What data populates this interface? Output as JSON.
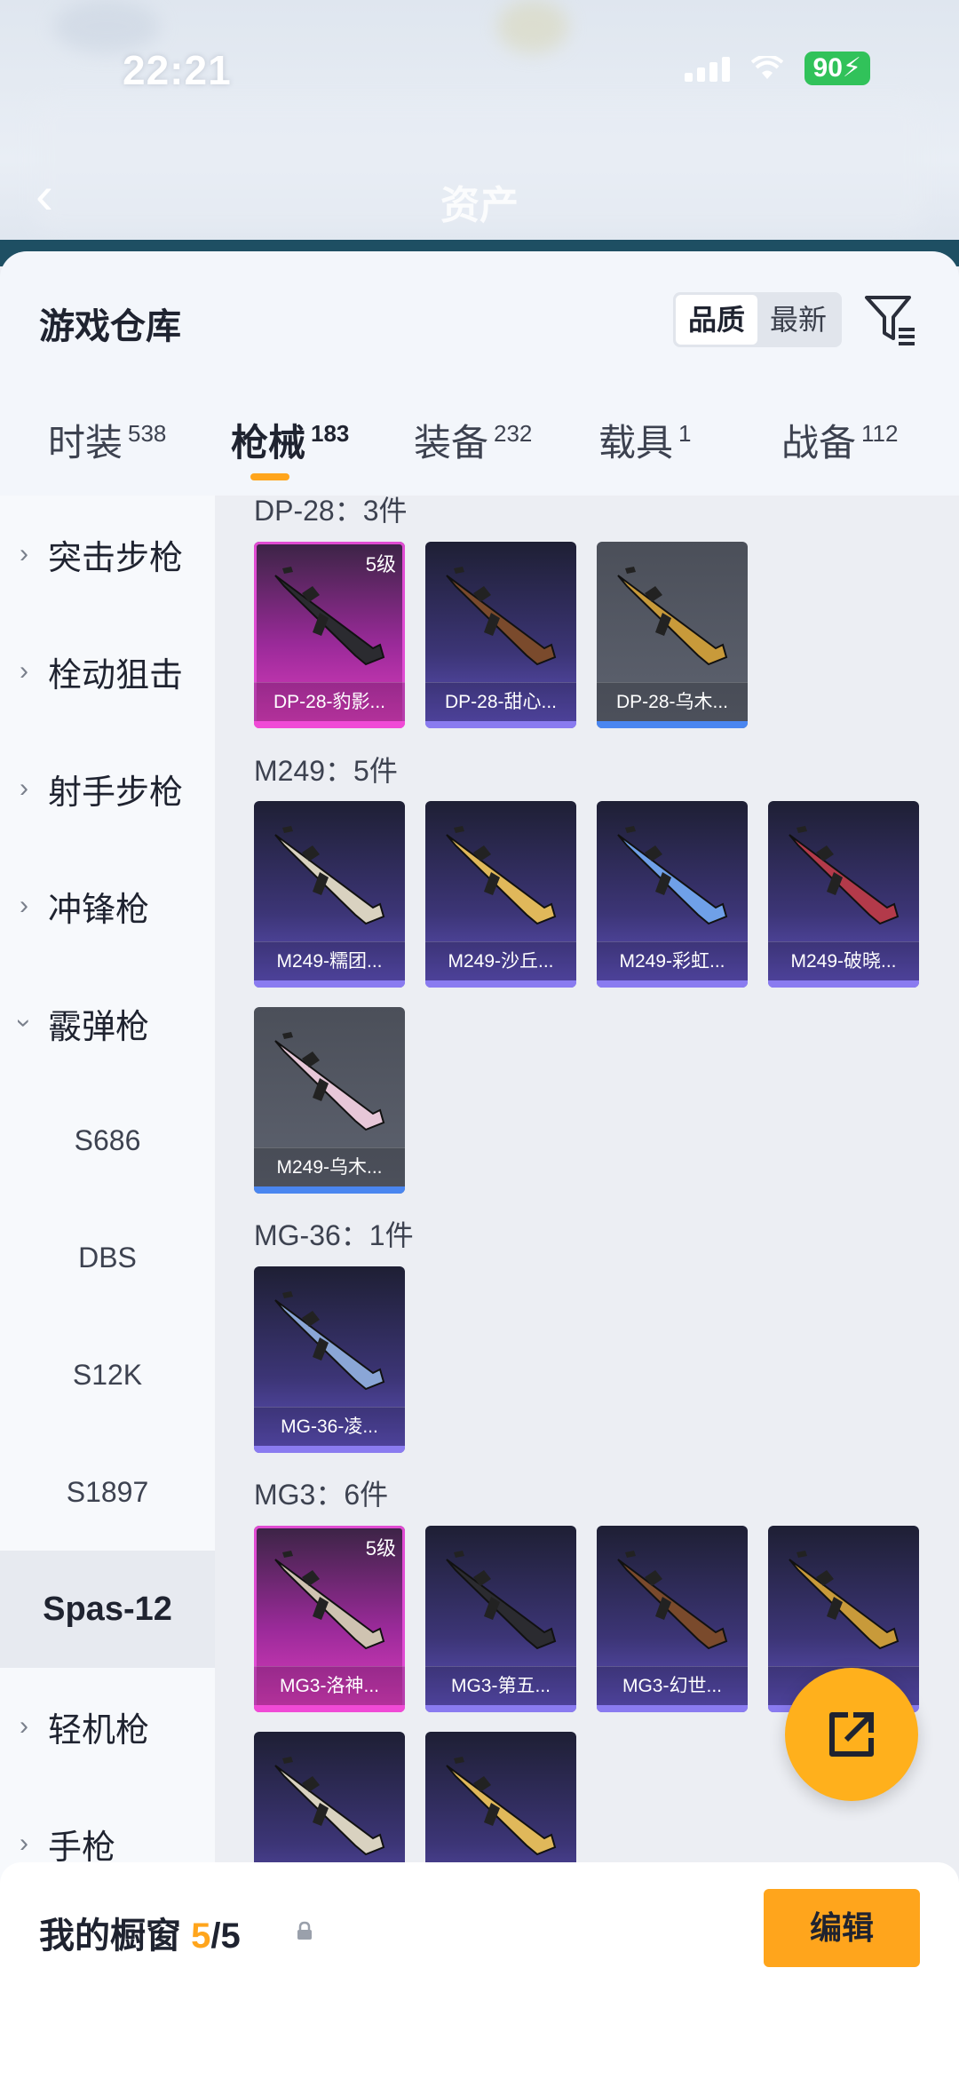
{
  "status_bar": {
    "time": "22:21",
    "battery": "90"
  },
  "nav": {
    "title": "资产",
    "back_icon": "chevron-left-icon"
  },
  "panel": {
    "title": "游戏仓库",
    "sort_options": [
      "品质",
      "最新"
    ],
    "sort_selected": "品质"
  },
  "tabs": [
    {
      "label": "时装",
      "count": "538"
    },
    {
      "label": "枪械",
      "count": "183",
      "active": true
    },
    {
      "label": "装备",
      "count": "232"
    },
    {
      "label": "载具",
      "count": "1"
    },
    {
      "label": "战备",
      "count": "112"
    }
  ],
  "sidebar": {
    "categories": [
      "突击步枪",
      "栓动狙击",
      "射手步枪",
      "冲锋枪",
      "霰弹枪"
    ],
    "sub_items": [
      "S686",
      "DBS",
      "S12K",
      "S1897",
      "Spas-12"
    ],
    "active_sub": "Spas-12",
    "after": [
      "轻机枪",
      "手枪"
    ]
  },
  "groups": [
    {
      "title": "DP-28：3件",
      "items": [
        {
          "name": "DP-28-豹影...",
          "rarity": "pink",
          "level": "5级"
        },
        {
          "name": "DP-28-甜心...",
          "rarity": "purple"
        },
        {
          "name": "DP-28-乌木...",
          "rarity": "grey"
        }
      ]
    },
    {
      "title": "M249：5件",
      "items": [
        {
          "name": "M249-糯团...",
          "rarity": "purple"
        },
        {
          "name": "M249-沙丘...",
          "rarity": "purple"
        },
        {
          "name": "M249-彩虹...",
          "rarity": "purple"
        },
        {
          "name": "M249-破晓...",
          "rarity": "purple"
        },
        {
          "name": "M249-乌木...",
          "rarity": "grey"
        }
      ]
    },
    {
      "title": "MG-36：1件",
      "items": [
        {
          "name": "MG-36-凌...",
          "rarity": "purple"
        }
      ]
    },
    {
      "title": "MG3：6件",
      "items": [
        {
          "name": "MG3-洛神...",
          "rarity": "pink",
          "level": "5级"
        },
        {
          "name": "MG3-第五...",
          "rarity": "purple"
        },
        {
          "name": "MG3-幻世...",
          "rarity": "purple"
        },
        {
          "name": "MG...",
          "rarity": "purple"
        },
        {
          "name": "",
          "rarity": "purple"
        },
        {
          "name": "",
          "rarity": "purple"
        }
      ]
    }
  ],
  "bottom": {
    "title": "我的橱窗",
    "count": "5",
    "total": "/5",
    "edit_label": "编辑"
  },
  "icons": {
    "filter": "filter-icon",
    "share": "share-external-icon",
    "lock": "lock-icon"
  },
  "colors": {
    "accent": "#ffa51c",
    "rarity_pink": "#e04bd2",
    "rarity_purple": "#8a7bf0",
    "rarity_grey": "#4a86f0"
  }
}
